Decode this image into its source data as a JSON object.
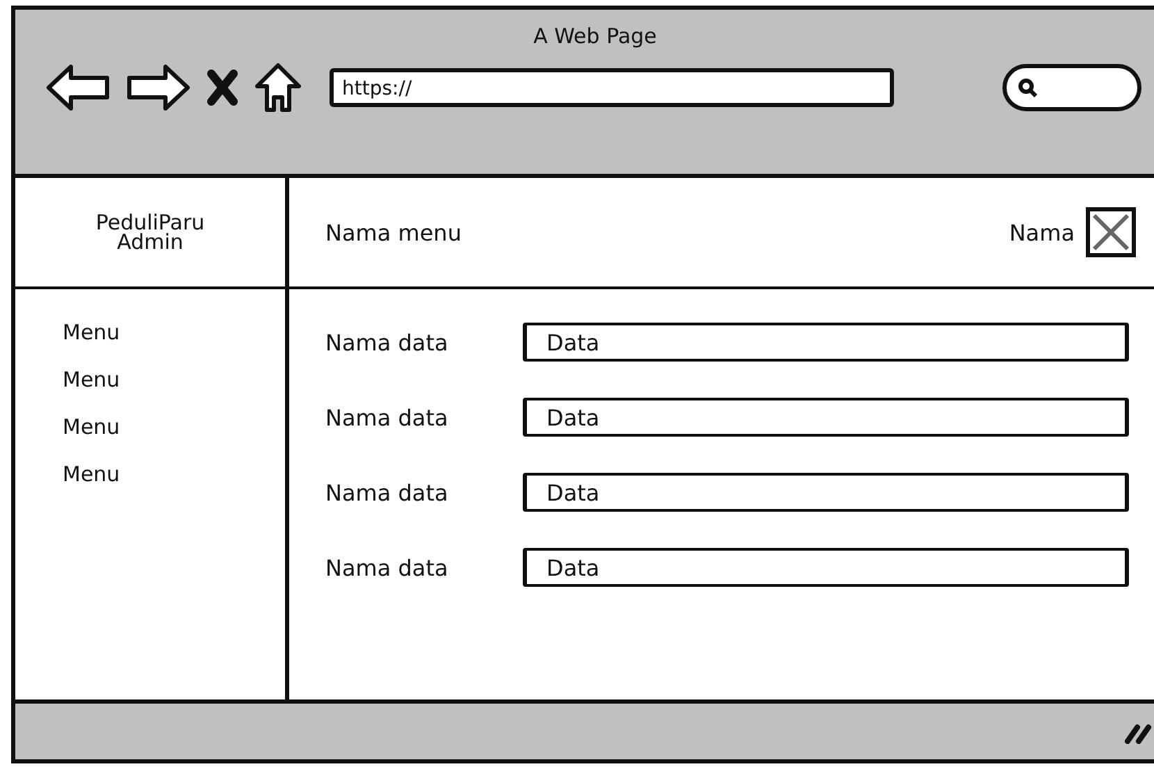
{
  "window": {
    "title": "A Web Page"
  },
  "browser": {
    "address": "https://"
  },
  "sidebar": {
    "brand_lines": [
      "PeduliParu",
      "Admin"
    ],
    "items": [
      "Menu",
      "Menu",
      "Menu",
      "Menu"
    ]
  },
  "header": {
    "title": "Nama menu",
    "user": "Nama"
  },
  "form": {
    "rows": [
      {
        "label": "Nama data",
        "value": "Data"
      },
      {
        "label": "Nama data",
        "value": "Data"
      },
      {
        "label": "Nama data",
        "value": "Data"
      },
      {
        "label": "Nama data",
        "value": "Data"
      }
    ]
  }
}
